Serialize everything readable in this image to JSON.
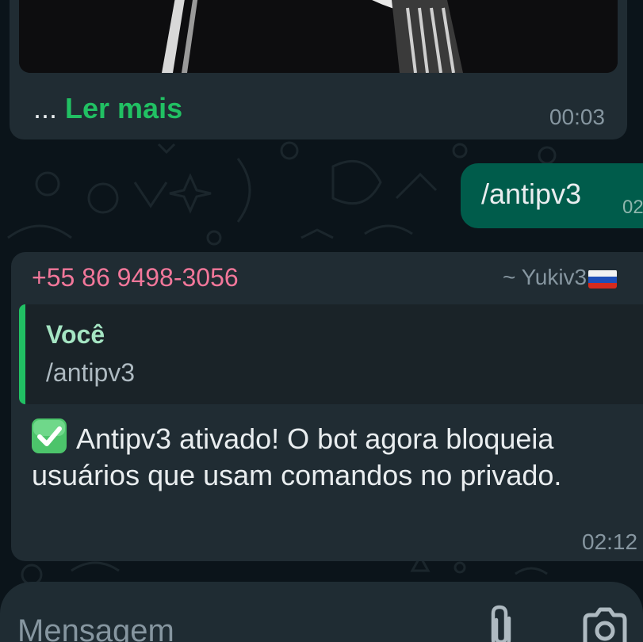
{
  "chat": {
    "top_message": {
      "prefix": "... ",
      "read_more": "Ler mais",
      "time": "00:03"
    },
    "outgoing_message": {
      "text": "/antipv3",
      "time": "02"
    },
    "reply_message": {
      "sender_number": "+55 86 9498-3056",
      "sender_pushname": "~ Yukiv3",
      "quoted_author": "Você",
      "quoted_text": "/antipv3",
      "body": "Antipv3 ativado! O bot agora bloqueia usuários que usam comandos no privado.",
      "time": "02:12"
    }
  },
  "composer": {
    "placeholder": "Mensagem"
  },
  "colors": {
    "background": "#0b141a",
    "incoming_bubble": "#202c33",
    "outgoing_bubble": "#005c4b",
    "accent_green": "#21c063",
    "sender_pink": "#f2779a"
  },
  "icons": {
    "flag": "russia-flag-icon",
    "check": "check-mark-button-icon",
    "attach": "paperclip-icon",
    "camera": "camera-icon"
  }
}
